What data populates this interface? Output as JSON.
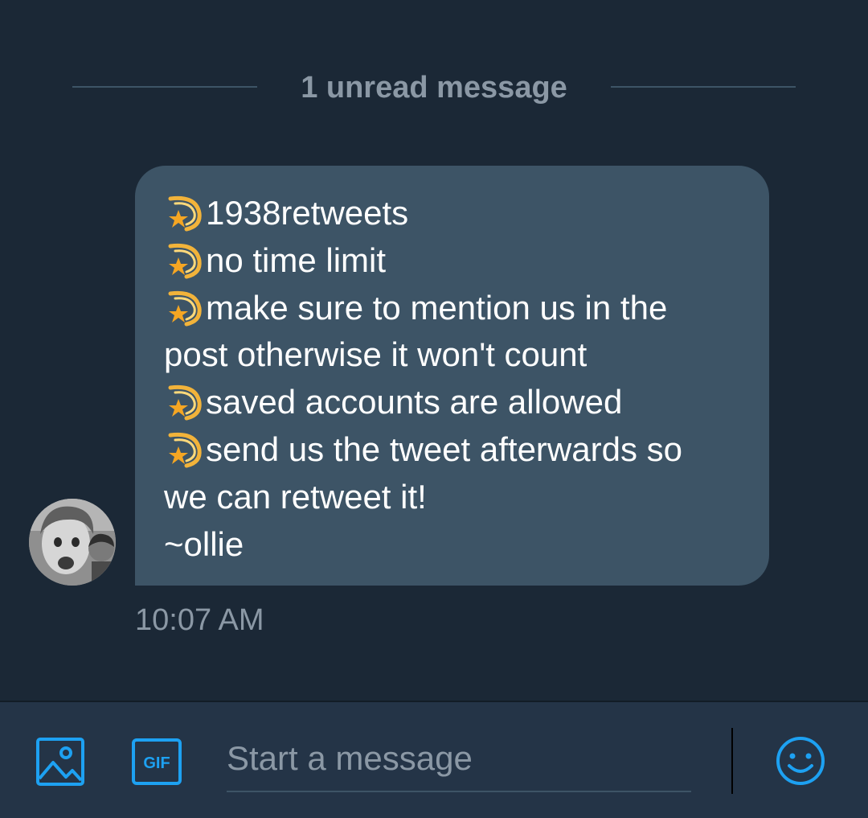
{
  "divider": {
    "label": "1 unread message"
  },
  "message": {
    "lines": [
      {
        "icon": "shooting-star-emoji",
        "text": "1938retweets"
      },
      {
        "icon": "shooting-star-emoji",
        "text": "no time limit"
      },
      {
        "icon": "shooting-star-emoji",
        "text": "make sure to mention us in the"
      },
      {
        "icon": null,
        "text": "post otherwise it won't count"
      },
      {
        "icon": "shooting-star-emoji",
        "text": "saved accounts are allowed"
      },
      {
        "icon": "shooting-star-emoji",
        "text": "send us the tweet afterwards so"
      },
      {
        "icon": null,
        "text": "we can retweet it!"
      },
      {
        "icon": null,
        "text": "~ollie"
      }
    ],
    "timestamp": "10:07 AM"
  },
  "composer": {
    "media_icon": "image-icon",
    "gif_label": "GIF",
    "placeholder": "Start a message",
    "emoji_icon": "smiley-icon"
  },
  "colors": {
    "background": "#1b2836",
    "bubble": "#3d5466",
    "composer": "#243447",
    "accent": "#1da1f2",
    "muted_text": "#8b98a5"
  }
}
